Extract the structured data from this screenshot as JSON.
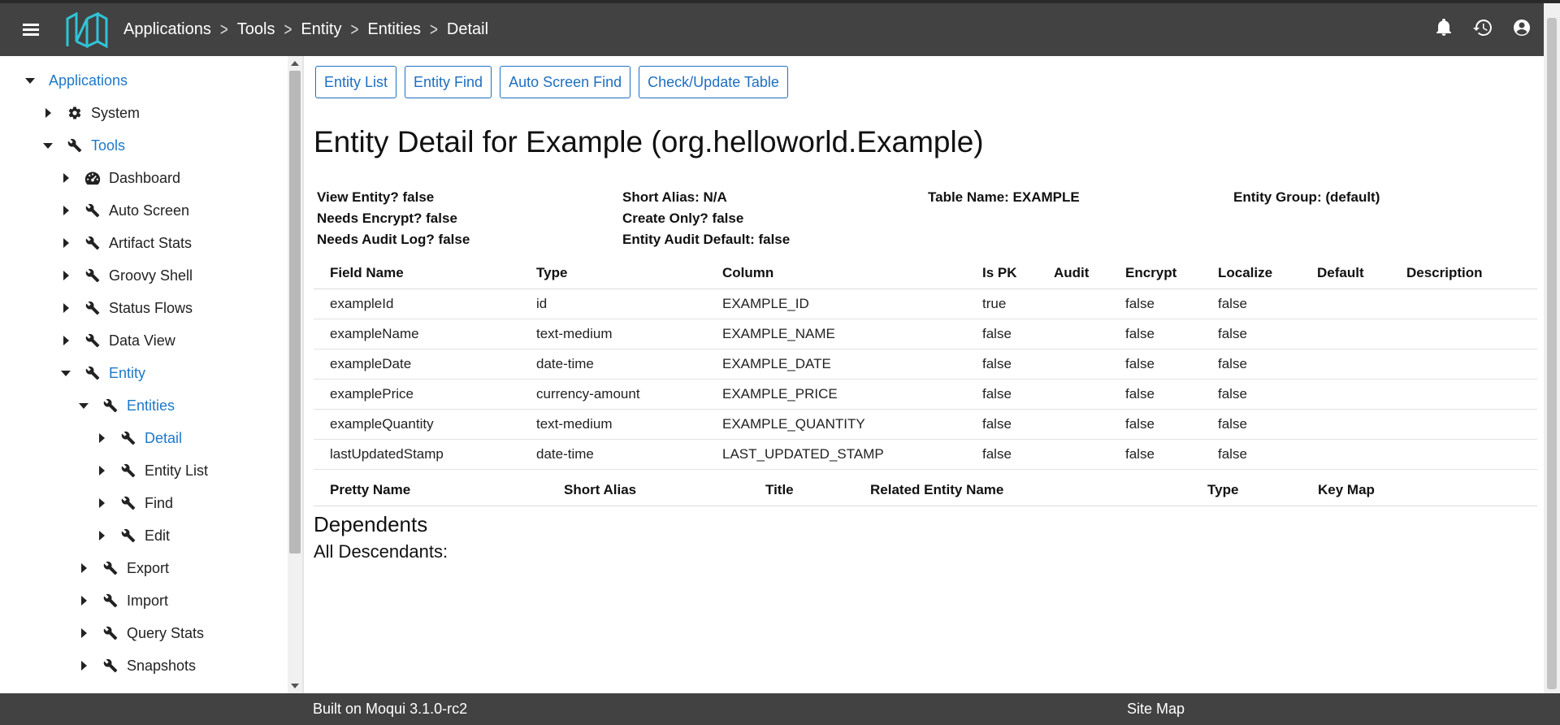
{
  "header": {
    "breadcrumbs": [
      "Applications",
      "Tools",
      "Entity",
      "Entities",
      "Detail"
    ]
  },
  "sidebar": {
    "items": [
      {
        "label": "Applications",
        "level": 0,
        "caret": "down",
        "icon": "",
        "active": true
      },
      {
        "label": "System",
        "level": 1,
        "caret": "right",
        "icon": "gear-icon",
        "active": false
      },
      {
        "label": "Tools",
        "level": 1,
        "caret": "down",
        "icon": "wrench-icon",
        "active": true
      },
      {
        "label": "Dashboard",
        "level": 2,
        "caret": "right",
        "icon": "dashboard-icon",
        "active": false
      },
      {
        "label": "Auto Screen",
        "level": 2,
        "caret": "right",
        "icon": "wrench-icon",
        "active": false
      },
      {
        "label": "Artifact Stats",
        "level": 2,
        "caret": "right",
        "icon": "wrench-icon",
        "active": false
      },
      {
        "label": "Groovy Shell",
        "level": 2,
        "caret": "right",
        "icon": "wrench-icon",
        "active": false
      },
      {
        "label": "Status Flows",
        "level": 2,
        "caret": "right",
        "icon": "wrench-icon",
        "active": false
      },
      {
        "label": "Data View",
        "level": 2,
        "caret": "right",
        "icon": "wrench-icon",
        "active": false
      },
      {
        "label": "Entity",
        "level": 2,
        "caret": "down",
        "icon": "wrench-icon",
        "active": true
      },
      {
        "label": "Entities",
        "level": 3,
        "caret": "down",
        "icon": "wrench-icon",
        "active": true
      },
      {
        "label": "Detail",
        "level": 4,
        "caret": "right",
        "icon": "wrench-icon",
        "active": true
      },
      {
        "label": "Entity List",
        "level": 4,
        "caret": "right",
        "icon": "wrench-icon",
        "active": false
      },
      {
        "label": "Find",
        "level": 4,
        "caret": "right",
        "icon": "wrench-icon",
        "active": false
      },
      {
        "label": "Edit",
        "level": 4,
        "caret": "right",
        "icon": "wrench-icon",
        "active": false
      },
      {
        "label": "Export",
        "level": 3,
        "caret": "right",
        "icon": "wrench-icon",
        "active": false
      },
      {
        "label": "Import",
        "level": 3,
        "caret": "right",
        "icon": "wrench-icon",
        "active": false
      },
      {
        "label": "Query Stats",
        "level": 3,
        "caret": "right",
        "icon": "wrench-icon",
        "active": false
      },
      {
        "label": "Snapshots",
        "level": 3,
        "caret": "right",
        "icon": "wrench-icon",
        "active": false
      }
    ]
  },
  "toolbar": {
    "buttons": [
      "Entity List",
      "Entity Find",
      "Auto Screen Find",
      "Check/Update Table"
    ]
  },
  "page": {
    "title": "Entity Detail for Example (org.helloworld.Example)"
  },
  "info": {
    "view_entity": "View Entity? false",
    "needs_encrypt": "Needs Encrypt? false",
    "needs_audit_log": "Needs Audit Log? false",
    "short_alias": "Short Alias: N/A",
    "create_only": "Create Only? false",
    "entity_audit_default": "Entity Audit Default: false",
    "table_name": "Table Name: EXAMPLE",
    "entity_group": "Entity Group: (default)"
  },
  "fields_table": {
    "headers": [
      "Field Name",
      "Type",
      "Column",
      "Is PK",
      "Audit",
      "Encrypt",
      "Localize",
      "Default",
      "Description"
    ],
    "rows": [
      [
        "exampleId",
        "id",
        "EXAMPLE_ID",
        "true",
        "",
        "false",
        "false",
        "",
        ""
      ],
      [
        "exampleName",
        "text-medium",
        "EXAMPLE_NAME",
        "false",
        "",
        "false",
        "false",
        "",
        ""
      ],
      [
        "exampleDate",
        "date-time",
        "EXAMPLE_DATE",
        "false",
        "",
        "false",
        "false",
        "",
        ""
      ],
      [
        "examplePrice",
        "currency-amount",
        "EXAMPLE_PRICE",
        "false",
        "",
        "false",
        "false",
        "",
        ""
      ],
      [
        "exampleQuantity",
        "text-medium",
        "EXAMPLE_QUANTITY",
        "false",
        "",
        "false",
        "false",
        "",
        ""
      ],
      [
        "lastUpdatedStamp",
        "date-time",
        "LAST_UPDATED_STAMP",
        "false",
        "",
        "false",
        "false",
        "",
        ""
      ]
    ]
  },
  "relationships_table": {
    "headers": [
      "Pretty Name",
      "Short Alias",
      "Title",
      "Related Entity Name",
      "Type",
      "Key Map"
    ]
  },
  "dependents": {
    "title": "Dependents",
    "all_descendants": "All Descendants:"
  },
  "footer": {
    "built_on": "Built on Moqui 3.1.0-rc2",
    "site_map": "Site Map"
  }
}
